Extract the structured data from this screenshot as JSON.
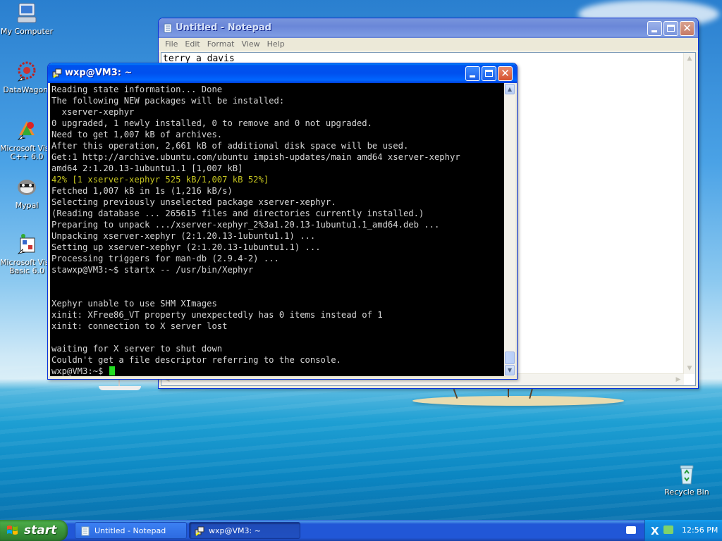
{
  "desktop": {
    "icons": [
      {
        "label": "My Computer",
        "icon": "my-computer-icon"
      },
      {
        "label": "DataWagon.",
        "icon": "datawagon-icon"
      },
      {
        "label": "Microsoft Visu C++ 6.0",
        "line1": "Microsoft Visu",
        "line2": "C++ 6.0",
        "icon": "visual-cpp-icon"
      },
      {
        "label": "Mypal",
        "icon": "mypal-icon"
      },
      {
        "label": "Microsoft Visu Basic 6.0",
        "line1": "Microsoft Visu",
        "line2": "Basic 6.0",
        "icon": "visual-basic-icon"
      },
      {
        "label": "Recycle Bin",
        "icon": "recycle-bin-icon"
      }
    ]
  },
  "notepad": {
    "title": "Untitled - Notepad",
    "menu": [
      "File",
      "Edit",
      "Format",
      "View",
      "Help"
    ],
    "content": "terry a davis"
  },
  "terminal": {
    "title": "wxp@VM3: ~",
    "lines": [
      "Reading state information... Done",
      "The following NEW packages will be installed:",
      "  xserver-xephyr",
      "0 upgraded, 1 newly installed, 0 to remove and 0 not upgraded.",
      "Need to get 1,007 kB of archives.",
      "After this operation, 2,661 kB of additional disk space will be used.",
      "Get:1 http://archive.ubuntu.com/ubuntu impish-updates/main amd64 xserver-xephyr",
      "amd64 2:1.20.13-1ubuntu1.1 [1,007 kB]",
      "42% [1 xserver-xephyr 525 kB/1,007 kB 52%]",
      "Fetched 1,007 kB in 1s (1,216 kB/s)",
      "Selecting previously unselected package xserver-xephyr.",
      "(Reading database ... 265615 files and directories currently installed.)",
      "Preparing to unpack .../xserver-xephyr_2%3a1.20.13-1ubuntu1.1_amd64.deb ...",
      "Unpacking xserver-xephyr (2:1.20.13-1ubuntu1.1) ...",
      "Setting up xserver-xephyr (2:1.20.13-1ubuntu1.1) ...",
      "Processing triggers for man-db (2.9.4-2) ...",
      "stawxp@VM3:~$ startx -- /usr/bin/Xephyr",
      "",
      "",
      "Xephyr unable to use SHM XImages",
      "xinit: XFree86_VT property unexpectedly has 0 items instead of 1",
      "xinit: connection to X server lost",
      "",
      "waiting for X server to shut down",
      "Couldn't get a file descriptor referring to the console.",
      "wxp@VM3:~$ "
    ],
    "progress_line_index": 8
  },
  "taskbar": {
    "start_label": "start",
    "items": [
      {
        "label": "Untitled - Notepad",
        "icon": "notepad-icon"
      },
      {
        "label": "wxp@VM3: ~",
        "icon": "terminal-icon"
      }
    ],
    "clock": "12:56 PM"
  },
  "colors": {
    "title_active": "#0050ee",
    "terminal_bg": "#000000",
    "terminal_fg": "#d6d6d6",
    "progress_text": "#c5c520",
    "cursor": "#22dd22",
    "start_green": "#378e37"
  }
}
